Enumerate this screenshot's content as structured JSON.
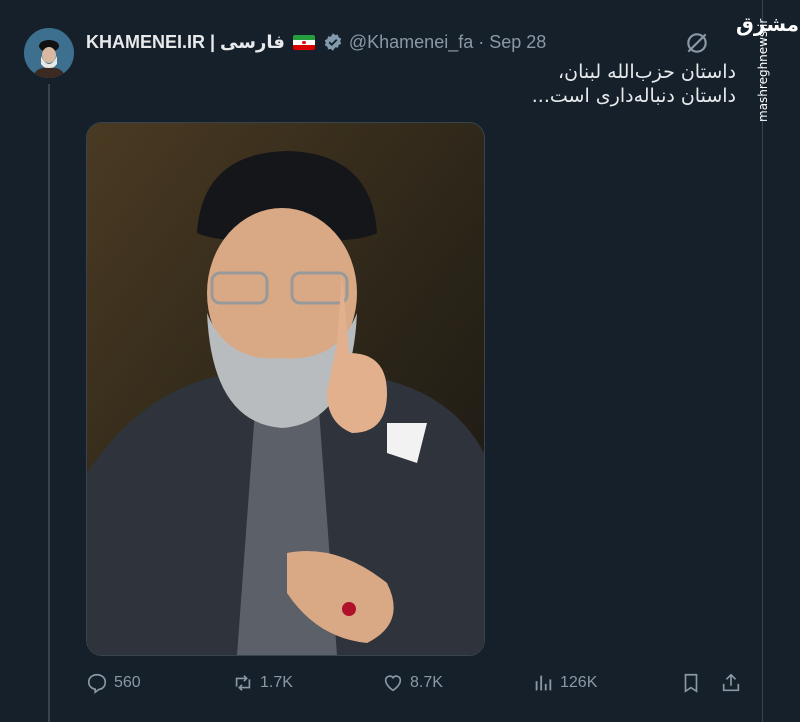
{
  "tweet": {
    "display_name": "KHAMENEI.IR | فارسی",
    "handle": "@Khamenei_fa",
    "separator": "·",
    "date": "Sep 28",
    "text_line1": "داستان حزب‌الله لبنان،",
    "text_line2": "داستان دنباله‌داری است..."
  },
  "actions": {
    "replies": "560",
    "reposts": "1.7K",
    "likes": "8.7K",
    "views": "126K"
  },
  "watermark": {
    "logo": "مشرق",
    "site": "mashreghnews.ir"
  },
  "colors": {
    "background": "#15202b",
    "text": "#e7e9ea",
    "muted": "#8b98a5",
    "border": "#38444d"
  }
}
